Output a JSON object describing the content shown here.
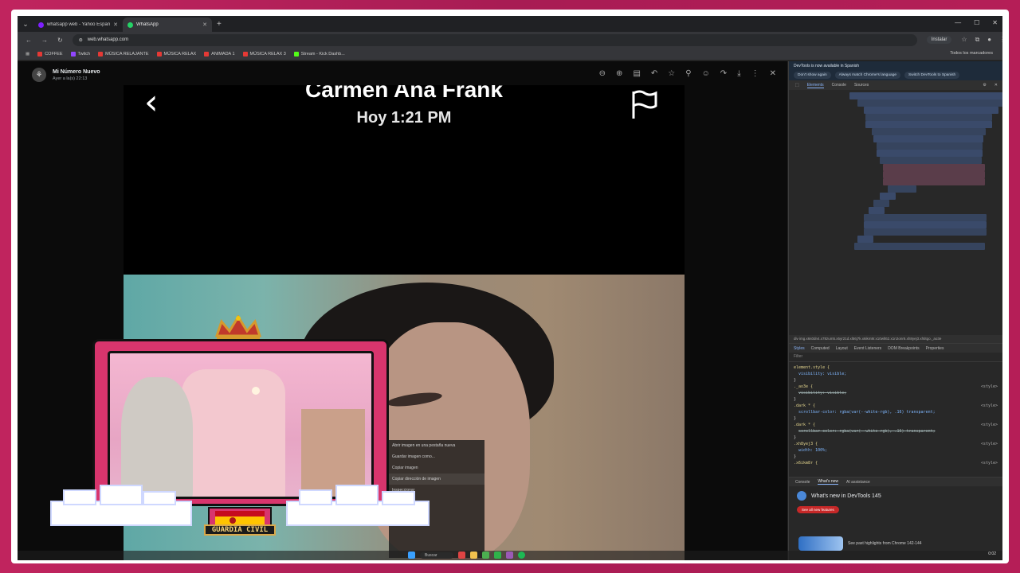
{
  "browser": {
    "tabs": [
      {
        "title": "whatsapp web - Yahoo España",
        "favicon_color": "#7e1fff"
      },
      {
        "title": "WhatsApp",
        "favicon_color": "#25d366"
      }
    ],
    "url": "web.whatsapp.com",
    "install_label": "Instalar",
    "bookmarks": [
      {
        "label": "COFFEE",
        "color": "#e53935"
      },
      {
        "label": "Twitch",
        "color": "#9146ff"
      },
      {
        "label": "MÚSICA RELAJANTE",
        "color": "#e53935"
      },
      {
        "label": "MÚSICA RELAX",
        "color": "#e53935"
      },
      {
        "label": "ANIMADA 1",
        "color": "#e53935"
      },
      {
        "label": "MÚSICA RELAX 3",
        "color": "#e53935"
      },
      {
        "label": "Stream - Kick Dashb...",
        "color": "#53fc18"
      }
    ],
    "bookmarks_right": "Todos los marcadores"
  },
  "viewer": {
    "contact_name": "Mi Número Nuevo",
    "contact_time": "Ayer a la(s) 22:13",
    "tool_icons": [
      "zoom-out-icon",
      "zoom-in-icon",
      "caption-icon",
      "undo-icon",
      "star-icon",
      "pin-icon",
      "emoji-icon",
      "forward-icon",
      "download-icon",
      "more-icon",
      "close-icon"
    ],
    "media": {
      "caller_name": "Carmen Ana Frank",
      "caller_time": "Hoy 1:21 PM"
    },
    "context_menu": [
      "Abrir imagen en una pestaña nueva",
      "Guardar imagen como...",
      "Copiar imagen",
      "Copiar dirección de imagen",
      "Inspeccionar"
    ]
  },
  "devtools": {
    "notice": "DevTools is now available in Spanish",
    "notice_buttons": [
      "Don't show again",
      "Always match Chrome's language",
      "Switch DevTools to Spanish"
    ],
    "tabs": [
      "Elements",
      "Console",
      "Sources"
    ],
    "breadcrumb": "div   img.x6s0dn4.x78zum5.x5yr21d.xl56j7k.x6ikm8r.x10wlt62.x1n2onr6.xh8yej3.xhtitgo._ao3e",
    "style_tabs": [
      "Styles",
      "Computed",
      "Layout",
      "Event Listeners",
      "DOM Breakpoints",
      "Properties"
    ],
    "filter_placeholder": "Filter",
    "style_rules": [
      {
        "selector": "element.style {",
        "prop": "",
        "src": ""
      },
      {
        "selector": "",
        "prop": "visibility: visible;",
        "src": ""
      },
      {
        "selector": "}",
        "prop": "",
        "src": ""
      },
      {
        "selector": "._ao3e {",
        "prop": "",
        "src": "<style>"
      },
      {
        "selector": "",
        "prop": "visibility: visible;",
        "src": ""
      },
      {
        "selector": "}",
        "prop": "",
        "src": ""
      },
      {
        "selector": ".dark * {",
        "prop": "",
        "src": "<style>"
      },
      {
        "selector": "",
        "prop": "scrollbar-color: rgba(var(--white-rgb), .16) transparent;",
        "src": ""
      },
      {
        "selector": "}",
        "prop": "",
        "src": ""
      },
      {
        "selector": ".dark * {",
        "prop": "",
        "src": "<style>"
      },
      {
        "selector": "",
        "prop": "scrollbar-color: rgba(var(--white-rgb), .16) transparent;",
        "src": ""
      },
      {
        "selector": "}",
        "prop": "",
        "src": ""
      },
      {
        "selector": ".xh8yej3 {",
        "prop": "",
        "src": "<style>"
      },
      {
        "selector": "",
        "prop": "width: 100%;",
        "src": ""
      },
      {
        "selector": "}",
        "prop": "",
        "src": ""
      },
      {
        "selector": ".x6ikm8r {",
        "prop": "",
        "src": "<style>"
      }
    ],
    "drawer_tabs": [
      "Console",
      "What's new",
      "AI assistance"
    ],
    "whats_new_title": "What's new in DevTools 145",
    "whats_new_button": "See all new features",
    "whats_new_footer": "See past highlights from Chrome 142-144"
  },
  "taskbar": {
    "search_label": "Buscar",
    "clock": "0:02"
  },
  "overlay": {
    "badge_text": "GUARDIA CIVIL"
  }
}
